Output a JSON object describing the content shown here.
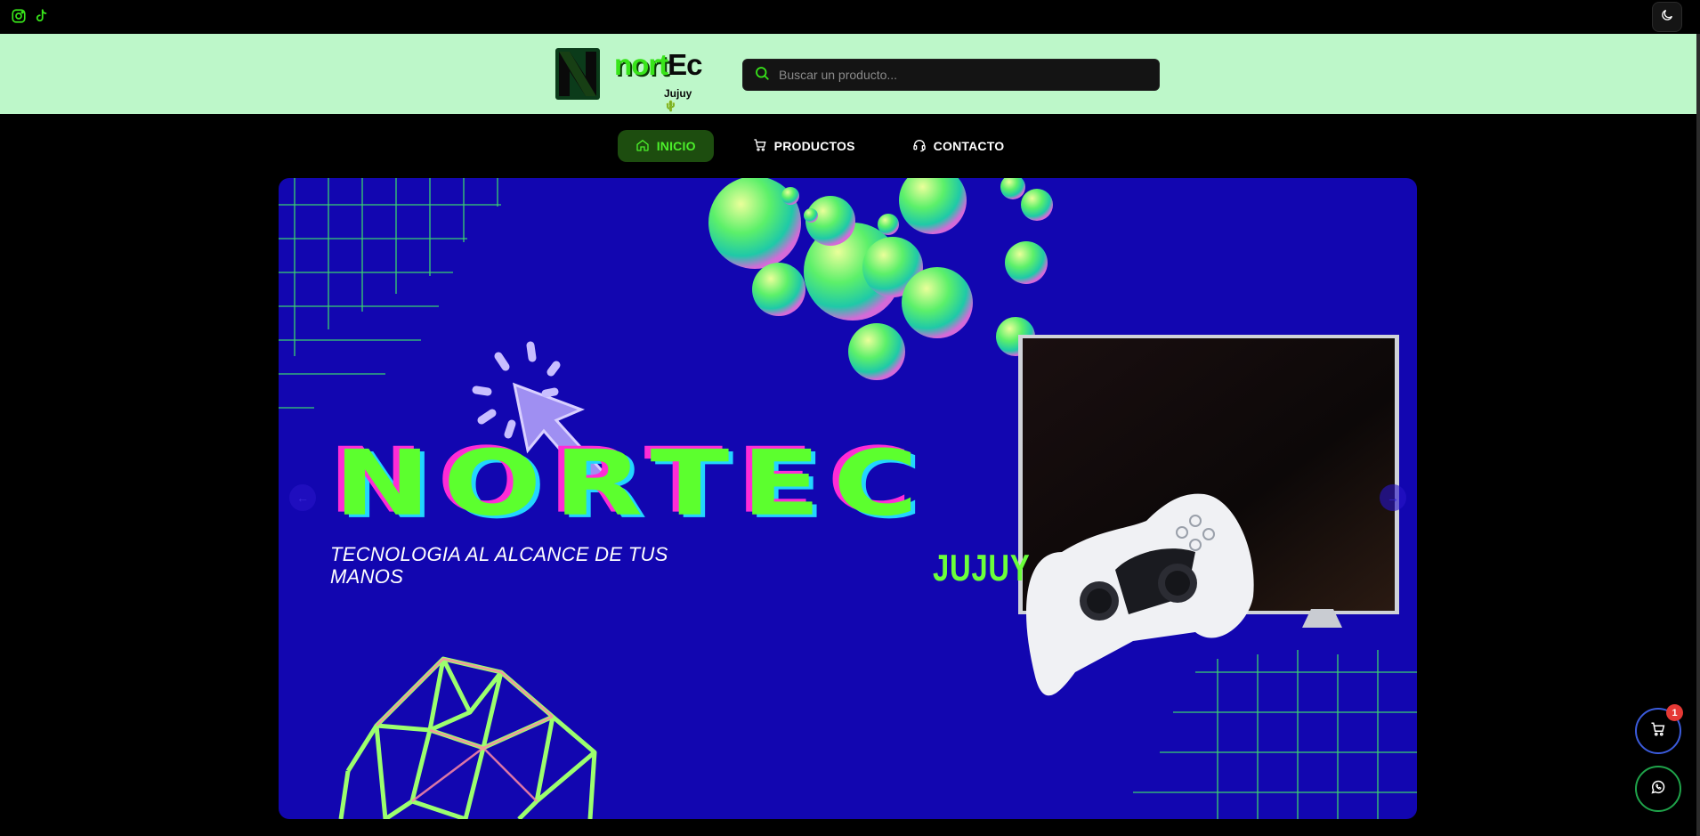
{
  "brand": {
    "word_green": "nort",
    "word_black": "Ec",
    "subtitle": "Jujuy 🌵",
    "accent": "#38e51a",
    "header_bg": "#bdf7c9"
  },
  "social": [
    {
      "icon": "instagram-icon"
    },
    {
      "icon": "tiktok-icon"
    }
  ],
  "search": {
    "placeholder": "Buscar un producto..."
  },
  "nav": {
    "items": [
      {
        "label": "INICIO",
        "icon": "home-icon",
        "active": true
      },
      {
        "label": "PRODUCTOS",
        "icon": "cart-icon",
        "active": false
      },
      {
        "label": "CONTACTO",
        "icon": "headset-icon",
        "active": false
      }
    ]
  },
  "hero": {
    "title": "NORTEC",
    "tagline": "TECNOLOGIA AL ALCANCE DE TUS MANOS",
    "city": "JUJUY",
    "background": "#1206b0"
  },
  "cart": {
    "count": "1"
  }
}
